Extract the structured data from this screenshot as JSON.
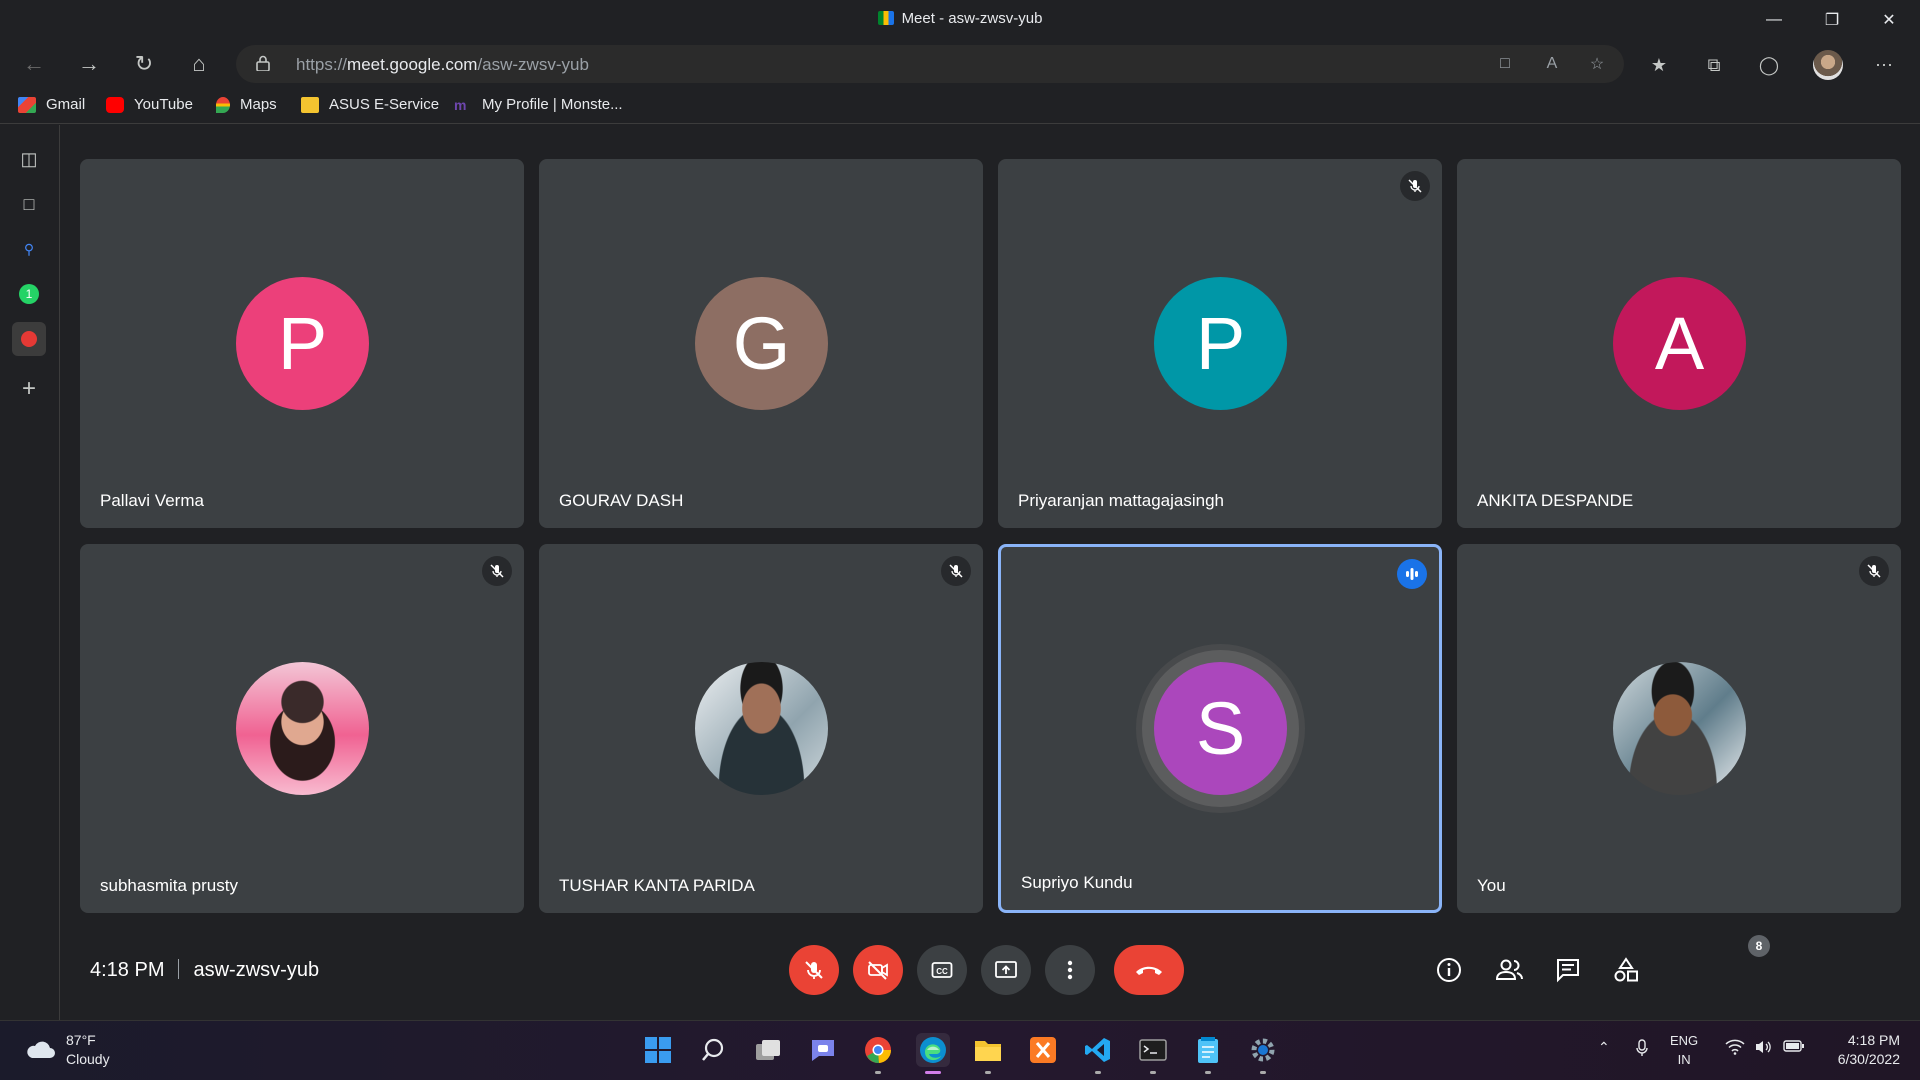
{
  "window": {
    "title": "Meet - asw-zwsv-yub"
  },
  "address_bar": {
    "url_prefix": "https://",
    "url_host": "meet.google.com",
    "url_path": "/asw-zwsv-yub"
  },
  "bookmarks": [
    {
      "label": "Gmail",
      "icon": "gmail-icon",
      "color": "#ea4335"
    },
    {
      "label": "YouTube",
      "icon": "youtube-icon",
      "color": "#ff0000"
    },
    {
      "label": "Maps",
      "icon": "maps-icon",
      "color": "#34a853"
    },
    {
      "label": "ASUS E-Service",
      "icon": "folder-icon",
      "color": "#f4c430"
    },
    {
      "label": "My Profile | Monste...",
      "icon": "monster-icon",
      "color": "#6e46ae"
    }
  ],
  "participants": [
    {
      "name": "Pallavi Verma",
      "initial": "P",
      "color": "#ec407a",
      "muted": false,
      "speaking": false
    },
    {
      "name": "GOURAV DASH",
      "initial": "G",
      "color": "#8d6e63",
      "muted": false,
      "speaking": false
    },
    {
      "name": "Priyaranjan mattagajasingh",
      "initial": "P",
      "color": "#0097a7",
      "muted": true,
      "speaking": false
    },
    {
      "name": "ANKITA DESPANDE",
      "initial": "A",
      "color": "#c2185b",
      "muted": false,
      "speaking": false
    },
    {
      "name": "subhasmita prusty",
      "initial": "",
      "color": "#f06292",
      "muted": true,
      "speaking": false
    },
    {
      "name": "TUSHAR KANTA PARIDA",
      "initial": "",
      "color": "#37474f",
      "muted": true,
      "speaking": false
    },
    {
      "name": "Supriyo Kundu",
      "initial": "S",
      "color": "#ab47bc",
      "muted": false,
      "speaking": true
    },
    {
      "name": "You",
      "initial": "",
      "color": "#78909c",
      "muted": true,
      "speaking": false
    }
  ],
  "meeting": {
    "time": "4:18 PM",
    "code": "asw-zwsv-yub",
    "participant_count": "8"
  },
  "taskbar": {
    "weather_temp": "87°F",
    "weather_desc": "Cloudy",
    "lang_1": "ENG",
    "lang_2": "IN",
    "clock_time": "4:18 PM",
    "clock_date": "6/30/2022"
  }
}
